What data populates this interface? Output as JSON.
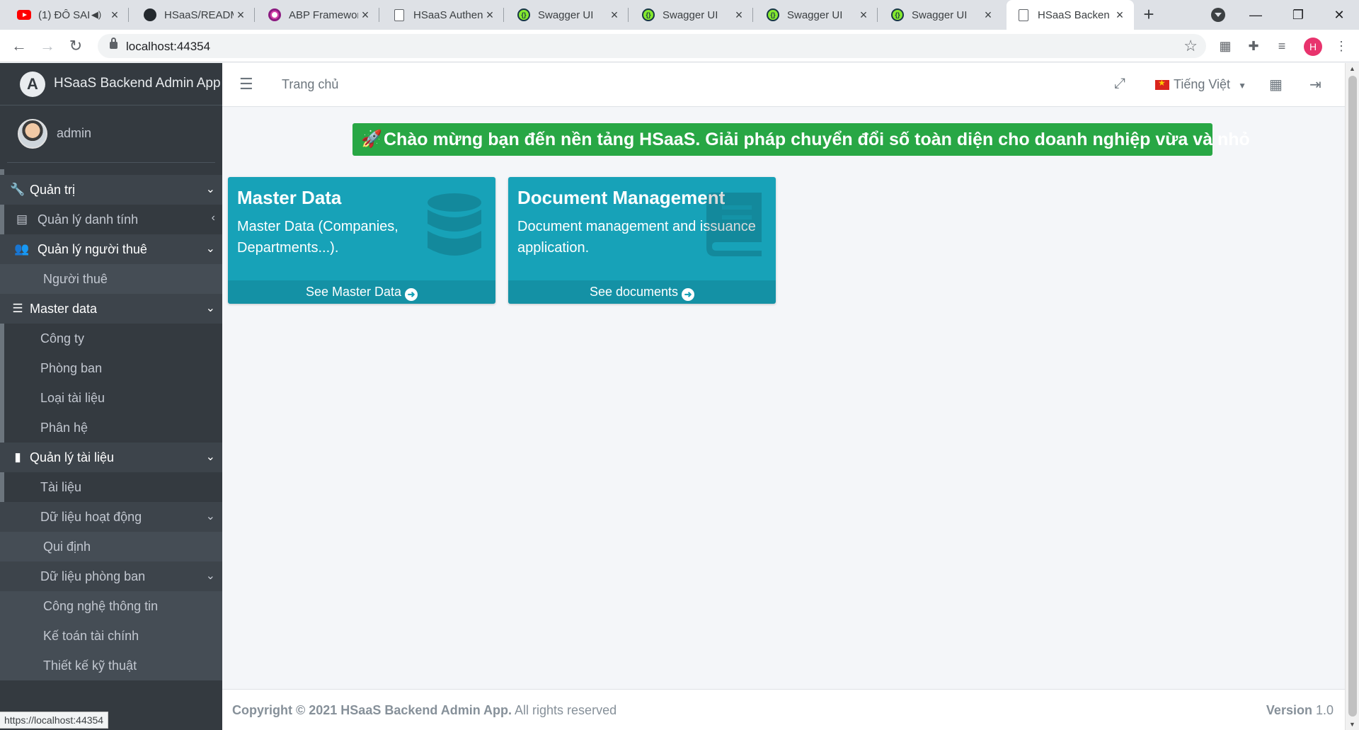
{
  "browser": {
    "tabs": [
      {
        "title": "(1) ĐÔ SAI",
        "icon": "youtube-icon"
      },
      {
        "title": "HSaaS/READM",
        "icon": "github-icon"
      },
      {
        "title": "ABP Framewor",
        "icon": "abp-icon"
      },
      {
        "title": "HSaaS Authen",
        "icon": "page-icon"
      },
      {
        "title": "Swagger UI",
        "icon": "swagger-icon"
      },
      {
        "title": "Swagger UI",
        "icon": "swagger-icon"
      },
      {
        "title": "Swagger UI",
        "icon": "swagger-icon"
      },
      {
        "title": "Swagger UI",
        "icon": "swagger-icon"
      },
      {
        "title": "HSaaS Backen",
        "icon": "page-icon"
      }
    ],
    "url": "localhost:44354",
    "profile_initial": "H",
    "status_url": "https://localhost:44354"
  },
  "brand": {
    "title": "HSaaS Backend Admin App",
    "logo_letter": "A"
  },
  "user": {
    "name": "admin"
  },
  "sidebar": {
    "items": [
      {
        "label": "Quản trị",
        "icon": "wrench-icon"
      },
      {
        "label": "Quản lý danh tính",
        "icon": "id-card-icon"
      },
      {
        "label": "Quản lý người thuê",
        "icon": "users-icon"
      },
      {
        "label": "Người thuê"
      },
      {
        "label": "Master data",
        "icon": "database-icon"
      },
      {
        "label": "Công ty"
      },
      {
        "label": "Phòng ban"
      },
      {
        "label": "Loại tài liệu"
      },
      {
        "label": "Phân hệ"
      },
      {
        "label": "Quản lý tài liệu",
        "icon": "book-icon"
      },
      {
        "label": "Tài liệu"
      },
      {
        "label": "Dữ liệu hoạt động"
      },
      {
        "label": "Qui định"
      },
      {
        "label": "Dữ liệu phòng ban"
      },
      {
        "label": "Công nghệ thông tin"
      },
      {
        "label": "Kế toán tài chính"
      },
      {
        "label": "Thiết kế kỹ thuật"
      }
    ]
  },
  "header": {
    "breadcrumb": "Trang chủ",
    "language": "Tiếng Việt"
  },
  "welcome": {
    "text": "Chào mừng bạn đến nền tảng HSaaS. Giải pháp chuyển đổi số toàn diện cho doanh nghiệp vừa và nhỏ"
  },
  "cards": [
    {
      "title": "Master Data",
      "description": "Master Data (Companies, Departments...).",
      "link": "See Master Data",
      "icon": "database-icon"
    },
    {
      "title": "Document Management",
      "description": "Document management and issuance application.",
      "link": "See documents",
      "icon": "book-icon"
    }
  ],
  "footer": {
    "copyright_bold": "Copyright © 2021 HSaaS Backend Admin App.",
    "copyright_rest": "All rights reserved",
    "version_label": "Version",
    "version": "1.0"
  },
  "colors": {
    "sidebar": "#343a40",
    "card": "#17a2b8",
    "welcome": "#28a745"
  }
}
